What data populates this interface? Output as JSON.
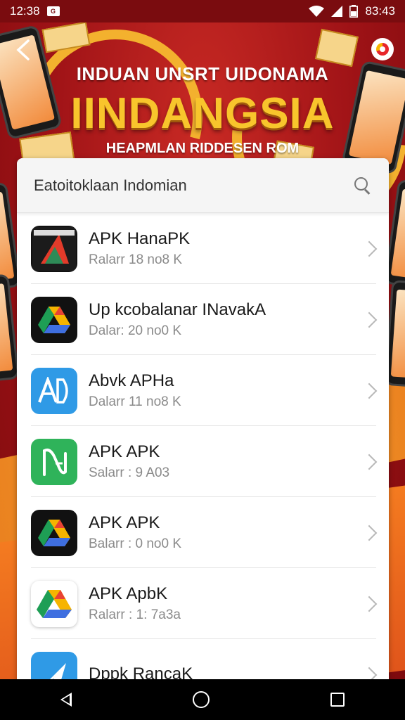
{
  "status_bar": {
    "time": "12:38",
    "clock_right": "83:43",
    "notif_badge": "G"
  },
  "banner": {
    "subtitle": "INDUAN UNSRT UIDONAMA",
    "title": "IINDANGSIA",
    "tagline": "HEAPMLAN RIDDESEN ROM"
  },
  "search": {
    "text": "Eatoitoklaan Indomian"
  },
  "apps": [
    {
      "title": "APK HanaPK",
      "sub": "Ralarr 18 no8 K",
      "icon": "book-cover-icon",
      "color": "#111111"
    },
    {
      "title": "Up kcobalanar INavakA",
      "sub": "Dalar: 20 no0 K",
      "icon": "drive-triangle-icon",
      "color": "#111111"
    },
    {
      "title": "Abvk APHa",
      "sub": "Dalarr 11 no8 K",
      "icon": "ad-blue-icon",
      "color": "#2f9ae6"
    },
    {
      "title": "APK APK",
      "sub": "Salarr : 9 A03",
      "icon": "green-n-icon",
      "color": "#2fb35a"
    },
    {
      "title": "APK APK",
      "sub": "Balarr : 0 no0 K",
      "icon": "drive-triangle-dark-icon",
      "color": "#111111"
    },
    {
      "title": "APK ApbK",
      "sub": "Ralarr : 1: 7a3a",
      "icon": "drive-triangle-light-icon",
      "color": "#ffffff"
    },
    {
      "title": "Dppk RancaK",
      "sub": "",
      "icon": "blue-arrow-icon",
      "color": "#2f9ae6"
    }
  ],
  "colors": {
    "banner_red": "#b5191c",
    "gold": "#f8c52c",
    "orange": "#f58a1f"
  }
}
